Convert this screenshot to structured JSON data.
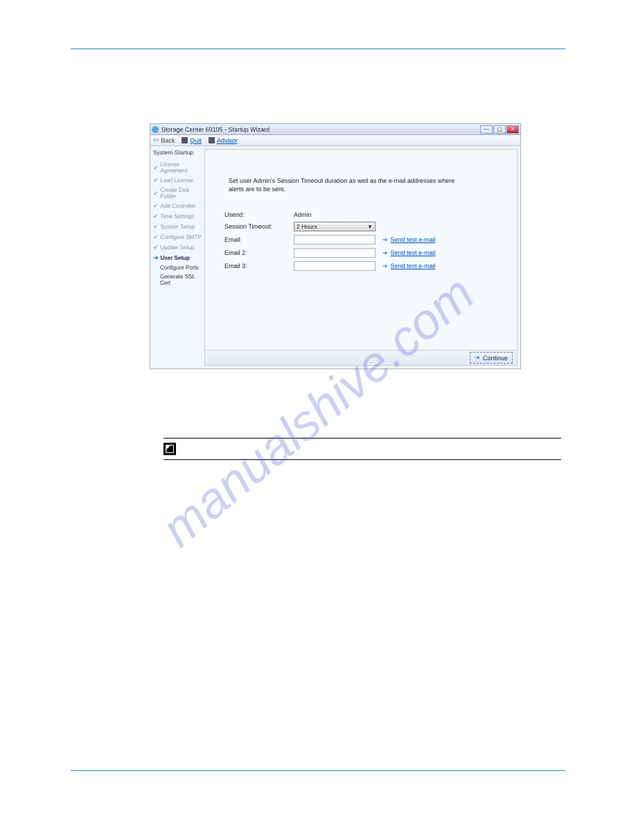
{
  "watermark": "manualshive.com",
  "wizard": {
    "title": "Storage Center 69105 - Startup Wizard",
    "toolbar": {
      "back": "Back",
      "quit": "Quit",
      "advisor": "Advisor"
    },
    "sidebar": {
      "title": "System Startup",
      "steps": [
        {
          "label": "License Agreement",
          "state": "done"
        },
        {
          "label": "Load License",
          "state": "done"
        },
        {
          "label": "Create Disk Folder",
          "state": "done"
        },
        {
          "label": "Add Controller",
          "state": "done"
        },
        {
          "label": "Time Settings",
          "state": "done"
        },
        {
          "label": "System Setup",
          "state": "done"
        },
        {
          "label": "Configure SMTP",
          "state": "done"
        },
        {
          "label": "Update Setup",
          "state": "done"
        },
        {
          "label": "User Setup",
          "state": "current"
        },
        {
          "label": "Configure Ports",
          "state": "pending"
        },
        {
          "label": "Generate SSL Cert",
          "state": "pending"
        }
      ]
    },
    "instruction": "Set user Admin's Session Timeout duration as well as the e-mail addresses where alerts are to be sent.",
    "form": {
      "userid_label": "Userid:",
      "userid_value": "Admin",
      "session_label": "Session Timeout:",
      "session_value": "2 Hours",
      "email_labels": [
        "Email:",
        "Email 2:",
        "Email 3:"
      ],
      "send_test": "Send test e-mail"
    },
    "continue": "Continue"
  }
}
